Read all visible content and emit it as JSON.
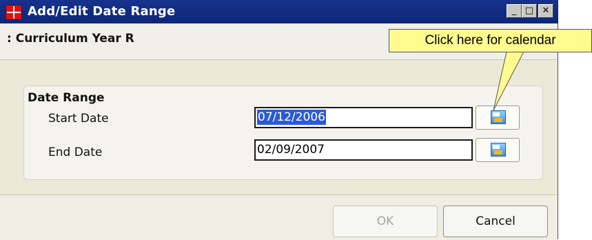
{
  "window": {
    "title": "Add/Edit Date Range",
    "title_buttons": {
      "minimize": "_",
      "maximize": "□",
      "close": "✕"
    }
  },
  "header": {
    "context": ": Curriculum Year  R"
  },
  "date_range": {
    "group_title": "Date Range",
    "start_label": "Start Date",
    "start_value": "07/12/2006",
    "end_label": "End Date",
    "end_value": "02/09/2007"
  },
  "footer": {
    "ok_label": "OK",
    "cancel_label": "Cancel"
  },
  "callout": {
    "text": "Click here for calendar"
  },
  "colors": {
    "titlebar": "#17328c",
    "selection": "#2a5bd7",
    "callout_bg": "#fffb8f"
  },
  "icons": [
    "app-grid-icon",
    "calendar-icon",
    "calendar-icon"
  ]
}
